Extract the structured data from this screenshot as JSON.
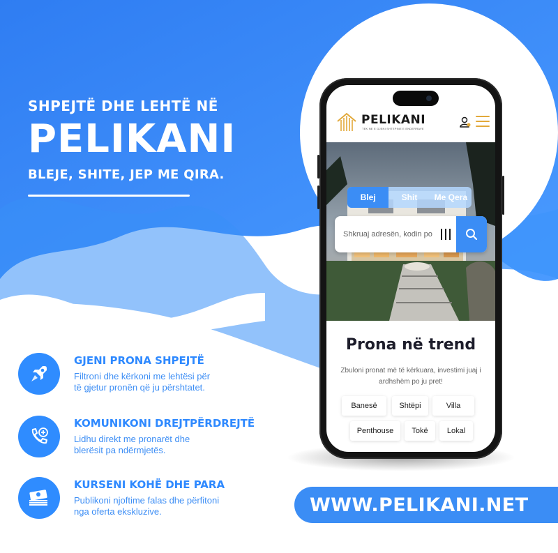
{
  "headline": {
    "kicker": "SHPEJTË DHE LEHTË NË",
    "brand": "PELIKANI",
    "tagline": "BLEJE, SHITE, JEP ME QIRA."
  },
  "features": [
    {
      "icon": "rocket-icon",
      "title": "GJENI PRONA SHPEJTË",
      "line1": "Filtroni dhe kërkoni me lehtësi për",
      "line2": "të gjetur pronën që ju përshtatet."
    },
    {
      "icon": "phone-call-icon",
      "title": "KOMUNIKONI DREJTPËRDREJTË",
      "line1": "Lidhu direkt me pronarët dhe",
      "line2": "blerësit pa ndërmjetës."
    },
    {
      "icon": "money-stack-icon",
      "title": "KURSENI KOHË DHE PARA",
      "line1": "Publikoni njoftime falas dhe përfitoni",
      "line2": "nga oferta ekskluzive."
    }
  ],
  "website_url": "WWW.PELIKANI.NET",
  "app": {
    "logo_text": "PELIKANI",
    "logo_subtitle": "TEK NE E GJENI SHTEPINE E ENDERRAVE",
    "tabs": [
      "Blej",
      "Shit",
      "Me Qera"
    ],
    "active_tab": "Blej",
    "search_placeholder": "Shkruaj adresën, kodin po",
    "trend_title": "Prona në trend",
    "trend_subtitle": "Zbuloni pronat më të kërkuara, investimi juaj i ardhshëm po ju pret!",
    "categories_row1": [
      "Banesë",
      "Shtëpi",
      "Villa"
    ],
    "categories_row2": [
      "Penthouse",
      "Tokë",
      "Lokal"
    ]
  },
  "colors": {
    "brand_blue": "#3b8df5",
    "logo_gold": "#e2a93b",
    "text_dark": "#1d1d2b"
  }
}
